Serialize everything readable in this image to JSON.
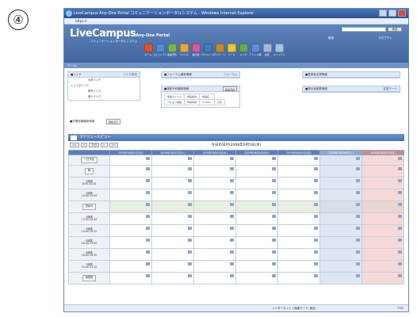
{
  "page_marker": "④",
  "window": {
    "title": "LiveCampus Any-One Portal コミュニケーションポータルシステム - Windows Internet Explorer",
    "address": "https://"
  },
  "header": {
    "logo": "LiveCampus",
    "logo_suffix": "Any-One Portal",
    "logo_sub": "コミュニケーションポータルシステム",
    "search_button": "検索",
    "logout": "ログアウト",
    "role": "教員"
  },
  "toolbar": [
    {
      "label": "ホーム",
      "color": "#e0532f"
    },
    {
      "label": "コミュニティ",
      "color": "#4f8ed1"
    },
    {
      "label": "施設予約",
      "color": "#7ab648"
    },
    {
      "label": "ファイル",
      "color": "#e4a93a"
    },
    {
      "label": "掲示板",
      "color": "#d65b9a"
    },
    {
      "label": "スケジュール",
      "color": "#3d7dc4"
    },
    {
      "label": "アンケート",
      "color": "#c28a2e"
    },
    {
      "label": "メール",
      "color": "#f2c12e"
    },
    {
      "label": "リンク",
      "color": "#6aa84f"
    },
    {
      "label": "アドレス帳",
      "color": "#5b8fd6"
    },
    {
      "label": "設定",
      "color": "#a4b8d6"
    },
    {
      "label": "マニュアル",
      "color": "#9ec6e8"
    }
  ],
  "breadcrumb": "ホーム",
  "panels": {
    "links": {
      "title": "■リンク",
      "more": "リンク設定",
      "rows": [
        "大学リンク",
        "ＬＬＩのリンク",
        "研究リンク",
        "個人リンク"
      ]
    },
    "forum": {
      "title": "■フォーラム最新情報",
      "more": "フォーラム"
    },
    "facility": {
      "title": "■施設予約最新情報",
      "button": "施設予約",
      "cells": [
        "施設タイトル",
        "施設案内",
        "施設名",
        "ベルより連絡",
        "申請情報",
        "13:00〜",
        "欠席"
      ]
    },
    "register": {
      "title": "■登録者名簿情報"
    },
    "bbs": {
      "title": "■掲示板新着情報",
      "more": "変更モード"
    },
    "survey": {
      "title": "■作業依頼最新情報",
      "button": "個別表示"
    }
  },
  "schedule": {
    "title": "スケジュールビュー",
    "nav": [
      "<<",
      "<",
      "今日",
      ">",
      ">>"
    ],
    "today_label": "今日の日付(2009年6月5日(木)",
    "days": [
      {
        "label": "2009年06月01日(月)",
        "type": "weekday"
      },
      {
        "label": "2009年06月02日(火)",
        "type": "weekday"
      },
      {
        "label": "2009年06月03日(水)",
        "type": "weekday"
      },
      {
        "label": "2009年06月04日(木)",
        "type": "weekday"
      },
      {
        "label": "2009年06月05日(金)",
        "type": "weekday"
      },
      {
        "label": "2009年06月06日(土)",
        "type": "sat"
      },
      {
        "label": "2009年06月07日(日)",
        "type": "sun"
      }
    ],
    "rows": [
      {
        "label": "一日予定",
        "boxed": true,
        "type": "day"
      },
      {
        "label": "朝",
        "boxed": true,
        "type": "slot"
      },
      {
        "label": "1時限\n8:50-10:20",
        "boxed": false,
        "type": "slot"
      },
      {
        "label": "2時限\n10:30-12:00",
        "boxed": false,
        "type": "slot"
      },
      {
        "label": "昼休み",
        "boxed": true,
        "type": "band"
      },
      {
        "label": "3時限\n13:00-14:30",
        "boxed": false,
        "type": "slot"
      },
      {
        "label": "4時限\n14:40-16:10",
        "boxed": false,
        "type": "slot"
      },
      {
        "label": "5時限\n16:20-17:50",
        "boxed": false,
        "type": "slot"
      },
      {
        "label": "6時限\n18:00-19:30",
        "boxed": false,
        "type": "slot"
      },
      {
        "label": "7時限\n19:40-21:10",
        "boxed": false,
        "type": "slot"
      },
      {
        "label": "夜間帯",
        "boxed": true,
        "type": "slot"
      }
    ]
  },
  "statusbar": {
    "zone": "インターネット | 保護モード: 無効",
    "zoom": "75%"
  }
}
